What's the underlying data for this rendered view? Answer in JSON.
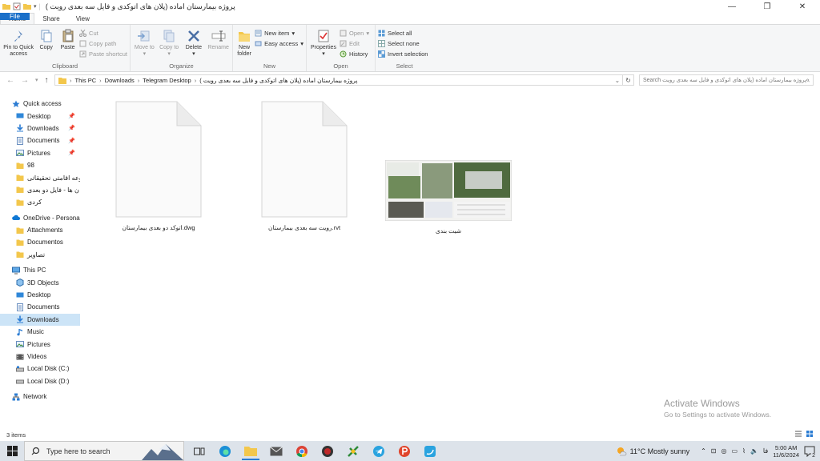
{
  "window": {
    "title": "پروژه بیمارستان اماده (پلان های اتوکدی و فایل سه بعدی رویت )",
    "minimize": "—",
    "maximize": "❐",
    "close": "✕"
  },
  "tabs": [
    {
      "label": "File"
    },
    {
      "label": "Home"
    },
    {
      "label": "Share"
    },
    {
      "label": "View"
    }
  ],
  "ribbon": {
    "clipboard": {
      "label": "Clipboard",
      "pin": "Pin to Quick access",
      "copy": "Copy",
      "paste": "Paste",
      "cut": "Cut",
      "copy_path": "Copy path",
      "paste_shortcut": "Paste shortcut"
    },
    "organize": {
      "label": "Organize",
      "move_to": "Move to",
      "copy_to": "Copy to",
      "delete": "Delete",
      "rename": "Rename"
    },
    "new": {
      "label": "New",
      "new_folder": "New folder",
      "new_item": "New item",
      "easy_access": "Easy access"
    },
    "open": {
      "label": "Open",
      "properties": "Properties",
      "open": "Open",
      "edit": "Edit",
      "history": "History"
    },
    "select": {
      "label": "Select",
      "select_all": "Select all",
      "select_none": "Select none",
      "invert_selection": "Invert selection"
    }
  },
  "address": {
    "crumbs": [
      "This PC",
      "Downloads",
      "Telegram Desktop",
      "پروژه بیمارستان اماده (پلان های اتوکدی و فایل سه بعدی رویت )"
    ],
    "search_placeholder": "Search پروژه بیمارستان اماده (پلان های اتوکدی و فایل سه بعدی رویت"
  },
  "sidebar": {
    "quick_access": "Quick access",
    "quick_items": [
      {
        "label": "Desktop",
        "pinned": true
      },
      {
        "label": "Downloads",
        "pinned": true
      },
      {
        "label": "Documents",
        "pinned": true
      },
      {
        "label": "Pictures",
        "pinned": true
      },
      {
        "label": "98",
        "pinned": false
      },
      {
        "label": "وعه اقامتی تحقیقاتی",
        "pinned": false
      },
      {
        "label": "ن ها - فایل دو بعدی )",
        "pinned": false
      },
      {
        "label": "کردی",
        "pinned": false
      }
    ],
    "onedrive": "OneDrive - Personal",
    "onedrive_items": [
      "Attachments",
      "Documentos",
      "تصاویر"
    ],
    "this_pc": "This PC",
    "pc_items": [
      "3D Objects",
      "Desktop",
      "Documents",
      "Downloads",
      "Music",
      "Pictures",
      "Videos",
      "Local Disk (C:)",
      "Local Disk (D:)"
    ],
    "network": "Network",
    "pin_glyph": "📌"
  },
  "files": [
    {
      "name": "اتوکد دو بعدی بیمارستان.dwg",
      "kind": "document"
    },
    {
      "name": "رویت سه بعدی بیمارستان.rvt",
      "kind": "document"
    },
    {
      "name": "شیت بندی",
      "kind": "image"
    }
  ],
  "status": {
    "item_count": "3 items"
  },
  "watermark": {
    "line1": "Activate Windows",
    "line2": "Go to Settings to activate Windows."
  },
  "taskbar": {
    "search_placeholder": "Type here to search",
    "weather": "11°C  Mostly sunny",
    "time": "5:00 AM",
    "date": "11/6/2024",
    "lang": "فا",
    "notifications": "2"
  },
  "colors": {
    "accent": "#1a6fc9",
    "folder": "#f3c74c",
    "selected": "#cce4f7",
    "onedrive": "#0f78d4"
  }
}
